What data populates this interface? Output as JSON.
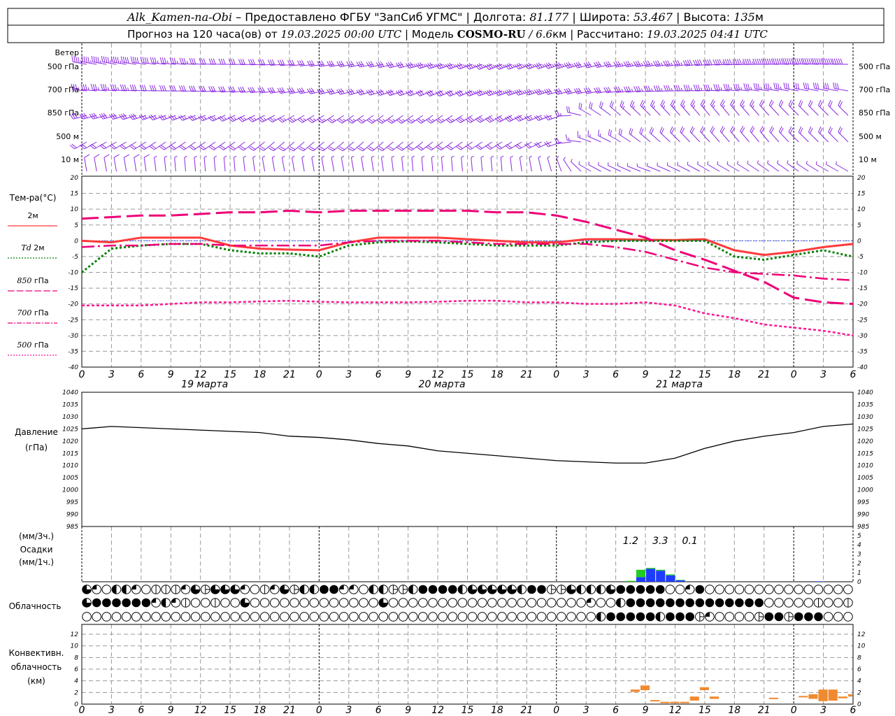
{
  "header": {
    "station": "Alk_Kamen-na-Obi",
    "provider": " – Предоставлено ФГБУ \"ЗапСиб УГМС\" | Долгота: ",
    "lon": "81.177",
    "lat_label": " | Широта: ",
    "lat": "53.467",
    "alt_label": " | Высота: ",
    "alt": "135",
    "alt_unit": "м",
    "forecast_label": "Прогноз на 120 часа(ов) от ",
    "forecast_start": "19.03.2025 00:00 UTC",
    "model_label": "  | Модель ",
    "model": "COSMO-RU",
    "model_sep": " / ",
    "resolution": "6.6",
    "res_unit_calc": "км | Рассчитано: ",
    "calculated": "19.03.2025 04:41 UTC"
  },
  "wind": {
    "title": "Ветер",
    "levels": [
      "500 гПа",
      "700 гПа",
      "850 гПа",
      "500 м",
      "10  м"
    ],
    "color": "#8a2be2",
    "dir_deg": [
      [
        280,
        280,
        278,
        275,
        272,
        270,
        268,
        265,
        262,
        260,
        258,
        255,
        252,
        250,
        248,
        250,
        252,
        255,
        258,
        260,
        262,
        265,
        268,
        270,
        272,
        272,
        270
      ],
      [
        275,
        275,
        272,
        270,
        268,
        265,
        262,
        260,
        258,
        255,
        252,
        250,
        248,
        248,
        250,
        252,
        255,
        258,
        262,
        266,
        270,
        272,
        275,
        278,
        280,
        280,
        280
      ],
      [
        255,
        255,
        252,
        250,
        248,
        245,
        242,
        240,
        238,
        236,
        235,
        235,
        236,
        238,
        240,
        245,
        250,
        300,
        310,
        315,
        318,
        320,
        320,
        318,
        315,
        315,
        315
      ],
      [
        240,
        240,
        238,
        236,
        235,
        235,
        232,
        230,
        230,
        230,
        230,
        232,
        234,
        236,
        238,
        240,
        250,
        290,
        300,
        310,
        315,
        318,
        320,
        320,
        315,
        315,
        315
      ],
      [
        350,
        350,
        352,
        355,
        355,
        355,
        350,
        350,
        350,
        350,
        352,
        355,
        355,
        355,
        355,
        350,
        340,
        300,
        295,
        290,
        295,
        300,
        300,
        305,
        305,
        300,
        300
      ]
    ],
    "speed_ms": [
      [
        22,
        22,
        20,
        18,
        16,
        16,
        15,
        15,
        14,
        15,
        16,
        16,
        17,
        18,
        18,
        18,
        17,
        16,
        16,
        17,
        18,
        20,
        22,
        24,
        26,
        26,
        26
      ],
      [
        17,
        17,
        16,
        16,
        15,
        15,
        15,
        15,
        15,
        16,
        16,
        16,
        16,
        16,
        17,
        17,
        16,
        15,
        16,
        17,
        18,
        18,
        18,
        17,
        16,
        16,
        16
      ],
      [
        14,
        14,
        14,
        13,
        13,
        13,
        13,
        13,
        13,
        13,
        13,
        13,
        13,
        14,
        14,
        14,
        13,
        10,
        11,
        12,
        12,
        12,
        12,
        11,
        11,
        11,
        11
      ],
      [
        11,
        11,
        11,
        10,
        10,
        10,
        10,
        10,
        10,
        10,
        10,
        10,
        10,
        10,
        11,
        11,
        10,
        8,
        9,
        10,
        10,
        10,
        10,
        9,
        9,
        9,
        9
      ],
      [
        4,
        4,
        4,
        3,
        3,
        3,
        3,
        3,
        3,
        3,
        3,
        3,
        3,
        3,
        3,
        3,
        3,
        3,
        2,
        2,
        3,
        3,
        3,
        3,
        3,
        3,
        3
      ]
    ]
  },
  "temperature": {
    "title": "Тем-ра(°C)",
    "legend": [
      {
        "label": "2м",
        "prefix": ""
      },
      {
        "label": "2м",
        "prefix": "Td"
      },
      {
        "label": "гПа",
        "prefix": "850"
      },
      {
        "label": "гПа",
        "prefix": "700"
      },
      {
        "label": "гПа",
        "prefix": "500"
      }
    ],
    "ticks": [
      "20",
      "15",
      "10",
      "5",
      "0",
      "-5",
      "-10",
      "-15",
      "-20",
      "-25",
      "-30",
      "-35",
      "-40"
    ]
  },
  "x_axis": {
    "ticks": [
      "0",
      "3",
      "6",
      "9",
      "12",
      "15",
      "18",
      "21",
      "0",
      "3",
      "6",
      "9",
      "12",
      "15",
      "18",
      "21",
      "0",
      "3",
      "6",
      "9",
      "12",
      "15",
      "18",
      "21",
      "0",
      "3",
      "6"
    ],
    "days": [
      "19 марта",
      "20 марта",
      "21 марта"
    ]
  },
  "pressure": {
    "title": "Давление",
    "unit": "(гПа)",
    "ticks": [
      "1040",
      "1035",
      "1030",
      "1025",
      "1020",
      "1015",
      "1010",
      "1005",
      "1000",
      "995",
      "990",
      "985"
    ]
  },
  "precip": {
    "unit3h": "(мм/3ч.)",
    "title": "Осадки",
    "unit1h": "(мм/1ч.)",
    "ticks": [
      "0",
      "1",
      "2",
      "3",
      "4",
      "5"
    ],
    "totals_3h": [
      {
        "label": "1.2",
        "from_h": 54
      },
      {
        "label": "3.3",
        "from_h": 57
      },
      {
        "label": "0.1",
        "from_h": 60
      }
    ],
    "colors": {
      "rain": "#1e3cff",
      "snow": "#22cc22"
    }
  },
  "clouds": {
    "title": "Облачность",
    "legend_codes": "o=clear q=quarter h=half t=three-quarter f=overcast v=vertical-bar e=split",
    "rows": [
      "tqohhqovvvqtetttqovqtehhffqqohheehffffhttttthffeethhhtfffffooqfooooooooooooooo",
      "tffffffqhqvoovootoooooooooooootooooooooooooooooooooqoohffffffffffffffooooovoovvvooo",
      "oooooooooooooooooooooooooooooooooooooooooooooooooooohfffffhfffeqooooeffefffoo"
    ]
  },
  "convective": {
    "title1": "Конвективн.",
    "title2": "облачность",
    "unit": "(км)",
    "ticks": [
      "0",
      "2",
      "4",
      "6",
      "8",
      "10",
      "12"
    ],
    "color": "#f08a30"
  },
  "chart_data": [
    {
      "type": "line",
      "title": "Тем-ра(°C)",
      "x_hours": [
        0,
        3,
        6,
        9,
        12,
        15,
        18,
        21,
        24,
        27,
        30,
        33,
        36,
        39,
        42,
        45,
        48,
        51,
        54,
        57,
        60,
        63,
        66,
        69,
        72,
        75,
        78
      ],
      "ylim": [
        -40,
        20
      ],
      "grid": true,
      "series": [
        {
          "name": "2м",
          "color": "#ff3a3a",
          "values": [
            0,
            -0.5,
            1,
            1,
            1,
            -1.5,
            -2.5,
            -2.8,
            -3,
            -0.5,
            1,
            1,
            1,
            0.5,
            0,
            -0.5,
            -0.5,
            0.5,
            0.5,
            0.3,
            0.2,
            0.5,
            -3,
            -4.5,
            -3.5,
            -2,
            -1
          ]
        },
        {
          "name": "Td 2м",
          "color": "#008000",
          "values": [
            -10,
            -2.5,
            -1.5,
            -1,
            -1,
            -3,
            -4,
            -4,
            -5,
            -1.5,
            -0.5,
            -0.2,
            -0.5,
            -1,
            -1.5,
            -1.5,
            -1.5,
            -0.5,
            0,
            0,
            0,
            0,
            -5,
            -6,
            -4.5,
            -3,
            -5
          ]
        },
        {
          "name": "850 гПа",
          "color": "#ee0077",
          "values": [
            7,
            7.5,
            8,
            8,
            8.5,
            9,
            9,
            9.5,
            9,
            9.5,
            9.5,
            9.5,
            9.5,
            9.5,
            9,
            9,
            8,
            6,
            3.5,
            1,
            -3,
            -6,
            -9.5,
            -13,
            -18,
            -19.5,
            -20
          ]
        },
        {
          "name": "700 гПа",
          "color": "#ee0077",
          "values": [
            -2,
            -1.5,
            -1.5,
            -1,
            -1,
            -1.5,
            -1.5,
            -1.5,
            -1.5,
            -0.5,
            0,
            0,
            0,
            -0.5,
            -1,
            -1,
            -1,
            -1,
            -2,
            -3.5,
            -6,
            -8.5,
            -10,
            -10.5,
            -11,
            -12,
            -12.5
          ]
        },
        {
          "name": "500 гПа",
          "color": "#ff1493",
          "values": [
            -20.5,
            -20.5,
            -20.5,
            -20,
            -19.5,
            -19.5,
            -19.2,
            -19,
            -19.3,
            -19.5,
            -19.5,
            -19.5,
            -19.3,
            -19,
            -19,
            -19.5,
            -19.5,
            -20,
            -20,
            -19.5,
            -20.5,
            -23,
            -24.5,
            -26.5,
            -27.5,
            -28.5,
            -30
          ]
        }
      ]
    },
    {
      "type": "line",
      "title": "Давление",
      "ylabel": "(гПа)",
      "x_hours": [
        0,
        3,
        6,
        9,
        12,
        15,
        18,
        21,
        24,
        27,
        30,
        33,
        36,
        39,
        42,
        45,
        48,
        51,
        54,
        57,
        60,
        63,
        66,
        69,
        72,
        75,
        78
      ],
      "ylim": [
        985,
        1040
      ],
      "series": [
        {
          "color": "#000000",
          "values": [
            1025,
            1026,
            1025.5,
            1025,
            1024.5,
            1024,
            1023.5,
            1022,
            1021.5,
            1020.5,
            1019,
            1018,
            1016,
            1015,
            1014,
            1013,
            1012,
            1011.5,
            1011,
            1011,
            1013,
            1017,
            1020,
            1022,
            1023.5,
            1026,
            1027
          ]
        }
      ]
    },
    {
      "type": "bar",
      "title": "Осадки",
      "ylabel": "(мм/1ч.)",
      "ylim": [
        0,
        5
      ],
      "bars": [
        {
          "hour": 55,
          "rain": 0,
          "snow": 0.1
        },
        {
          "hour": 56,
          "rain": 0.5,
          "snow": 0.8
        },
        {
          "hour": 57,
          "rain": 1.4,
          "snow": 0.1
        },
        {
          "hour": 58,
          "rain": 1.2,
          "snow": 0.1
        },
        {
          "hour": 59,
          "rain": 0.7,
          "snow": 0.1
        },
        {
          "hour": 60,
          "rain": 0.15,
          "snow": 0.05
        },
        {
          "hour": 74,
          "rain": 0.05,
          "snow": 0
        }
      ]
    },
    {
      "type": "bar",
      "title": "Конвективн. облачность",
      "ylabel": "(км)",
      "ylim": [
        0,
        13
      ],
      "grid": true,
      "layers": [
        {
          "hour": 56,
          "base": 2.1,
          "top": 2.5
        },
        {
          "hour": 57,
          "base": 2.4,
          "top": 3.2
        },
        {
          "hour": 58,
          "base": 0.5,
          "top": 0.7
        },
        {
          "hour": 59,
          "base": 0.3,
          "top": 0.4
        },
        {
          "hour": 60,
          "base": 0.3,
          "top": 0.4
        },
        {
          "hour": 61,
          "base": 0.3,
          "top": 0.4
        },
        {
          "hour": 62,
          "base": 0.6,
          "top": 1.3
        },
        {
          "hour": 63,
          "base": 2.4,
          "top": 2.9
        },
        {
          "hour": 64,
          "base": 0.9,
          "top": 1.3
        },
        {
          "hour": 70,
          "base": 0.9,
          "top": 1.1
        },
        {
          "hour": 73,
          "base": 1.2,
          "top": 1.4
        },
        {
          "hour": 74,
          "base": 0.9,
          "top": 1.7
        },
        {
          "hour": 75,
          "base": 0.5,
          "top": 2.5
        },
        {
          "hour": 76,
          "base": 0.6,
          "top": 2.5
        },
        {
          "hour": 77,
          "base": 1.0,
          "top": 1.3
        },
        {
          "hour": 78,
          "base": 1.3,
          "top": 1.7
        }
      ]
    }
  ]
}
